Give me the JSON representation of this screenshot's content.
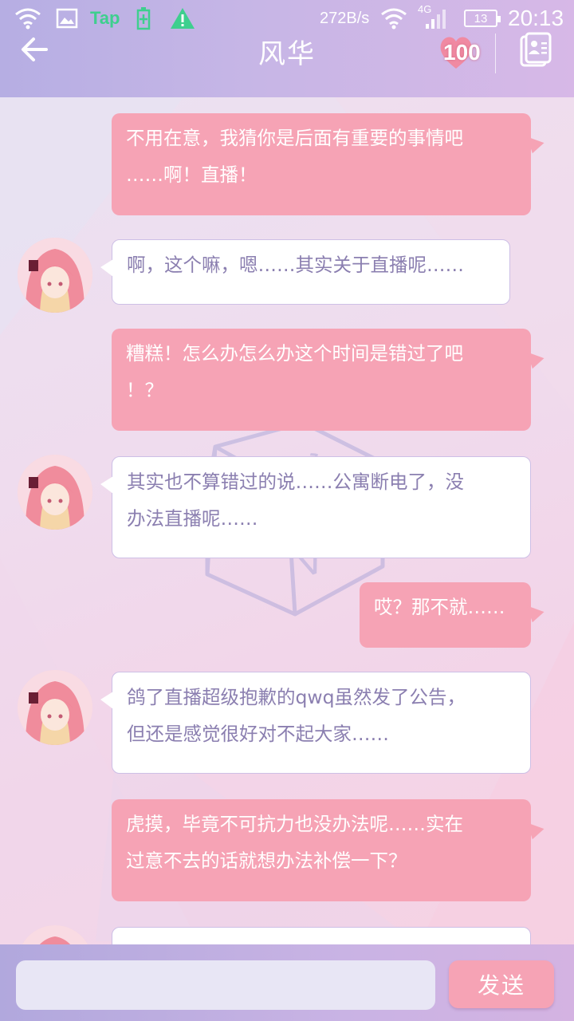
{
  "status_bar": {
    "tap_label": "Tap",
    "net_speed": "272B/s",
    "network_type": "4G",
    "battery": "13",
    "time": "20:13"
  },
  "header": {
    "title": "风华",
    "heart_value": "100",
    "back_icon": "back-arrow-icon",
    "contact_icon": "contact-card-icon"
  },
  "messages": [
    {
      "from": "user",
      "lines": [
        "不用在意，我猜你是后面有重要的事情吧",
        "……啊！直播！"
      ]
    },
    {
      "from": "bot",
      "lines": [
        "啊，这个嘛，嗯……其实关于直播呢……"
      ]
    },
    {
      "from": "user",
      "lines": [
        "糟糕！怎么办怎么办这个时间是错过了吧",
        "！？"
      ]
    },
    {
      "from": "bot",
      "lines": [
        "其实也不算错过的说……公寓断电了，没",
        "办法直播呢……"
      ]
    },
    {
      "from": "user",
      "lines": [
        "哎？那不就……"
      ]
    },
    {
      "from": "bot",
      "lines": [
        "鸽了直播超级抱歉的qwq虽然发了公告，",
        "但还是感觉很好对不起大家……"
      ]
    },
    {
      "from": "user",
      "lines": [
        "虎摸，毕竟不可抗力也没办法呢……实在",
        "过意不去的话就想办法补偿一下？"
      ]
    },
    {
      "from": "bot",
      "lines": [
        ""
      ]
    }
  ],
  "composer": {
    "input_value": "",
    "input_placeholder": "",
    "send_label": "发送"
  },
  "colors": {
    "user_bubble": "#f6a3b5",
    "bot_bubble": "#ffffff",
    "bot_text": "#8b7fb0",
    "header_bg": "#c7b6e6"
  }
}
